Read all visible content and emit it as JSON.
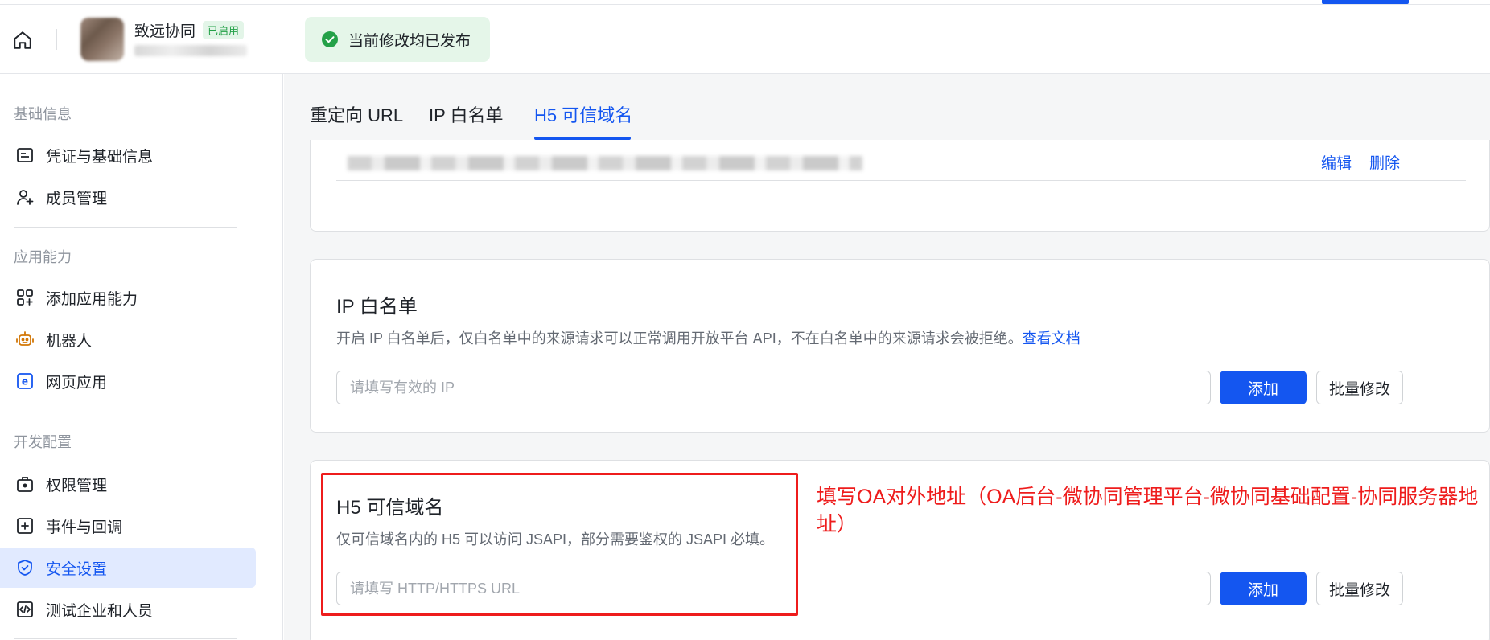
{
  "topbar": {
    "app_name": "致远协同",
    "app_status": "已启用",
    "toast_text": "当前修改均已发布"
  },
  "sidebar": {
    "groups": [
      {
        "label": "基础信息"
      },
      {
        "label": "应用能力"
      },
      {
        "label": "开发配置"
      }
    ],
    "items": [
      {
        "label": "凭证与基础信息",
        "icon": "credential-icon"
      },
      {
        "label": "成员管理",
        "icon": "member-add-icon"
      },
      {
        "label": "添加应用能力",
        "icon": "grid-add-icon"
      },
      {
        "label": "机器人",
        "icon": "robot-icon"
      },
      {
        "label": "网页应用",
        "icon": "web-app-icon"
      },
      {
        "label": "权限管理",
        "icon": "permission-icon"
      },
      {
        "label": "事件与回调",
        "icon": "event-icon"
      },
      {
        "label": "安全设置",
        "icon": "shield-icon",
        "active": true
      },
      {
        "label": "测试企业和人员",
        "icon": "code-icon"
      }
    ]
  },
  "tabs": [
    {
      "label": "重定向 URL"
    },
    {
      "label": "IP 白名单"
    },
    {
      "label": "H5 可信域名",
      "active": true
    }
  ],
  "redirect_card": {
    "edit_label": "编辑",
    "delete_label": "删除"
  },
  "ip_card": {
    "title": "IP 白名单",
    "desc": "开启 IP 白名单后，仅白名单中的来源请求可以正常调用开放平台 API，不在白名单中的来源请求会被拒绝。",
    "doc_link": "查看文档",
    "placeholder": "请填写有效的 IP",
    "add_label": "添加",
    "batch_label": "批量修改"
  },
  "h5_card": {
    "title": "H5 可信域名",
    "desc": "仅可信域名内的 H5 可以访问 JSAPI，部分需要鉴权的 JSAPI 必填。",
    "placeholder": "请填写 HTTP/HTTPS URL",
    "add_label": "添加",
    "batch_label": "批量修改"
  },
  "annotation": "填写OA对外地址（OA后台-微协同管理平台-微协同基础配置-协同服务器地址）",
  "colors": {
    "accent": "#1456f0",
    "annotation": "#ee1c1c",
    "success": "#24a148"
  }
}
